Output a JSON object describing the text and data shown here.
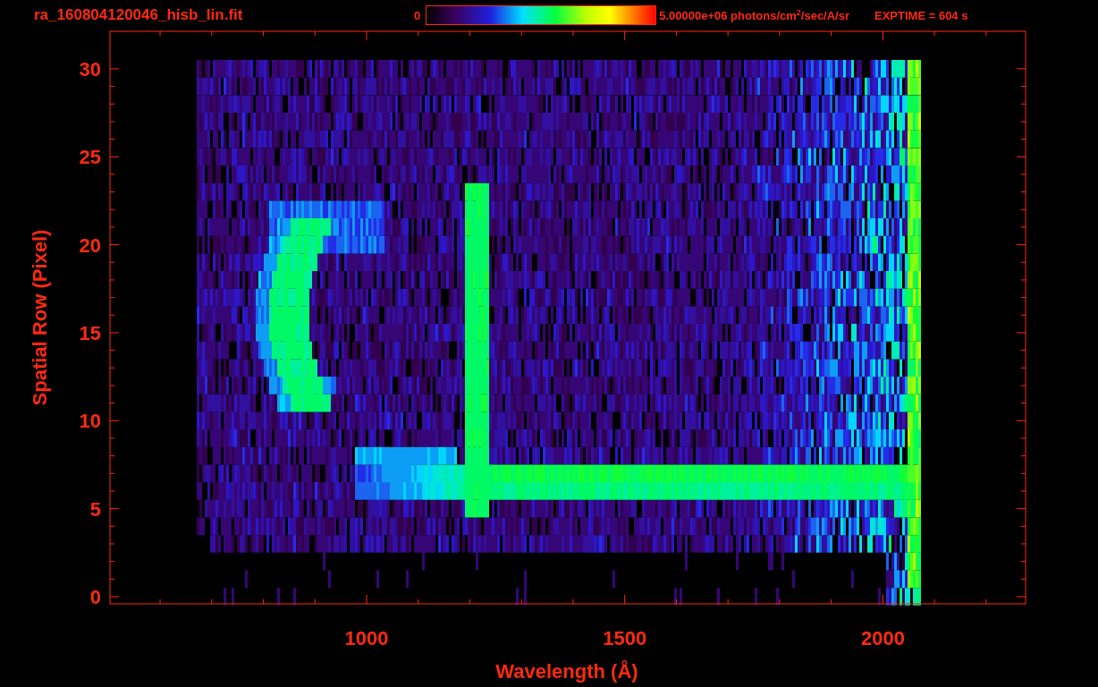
{
  "title": "ra_160804120046_hisb_lin.fit",
  "colorbar": {
    "min_label": "0",
    "max_label": "5.00000e+06 photons/cm$^{2}$/sec/A/sr"
  },
  "exposure": "EXPTIME = 604 s",
  "y_axis": {
    "label": "Spatial Row (Pixel)",
    "ticks": [
      "30",
      "25",
      "20",
      "15",
      "10",
      "5",
      "0"
    ]
  },
  "x_axis": {
    "label": "Wavelength (Å)",
    "ticks": [
      "1000",
      "1500",
      "2000"
    ]
  }
}
